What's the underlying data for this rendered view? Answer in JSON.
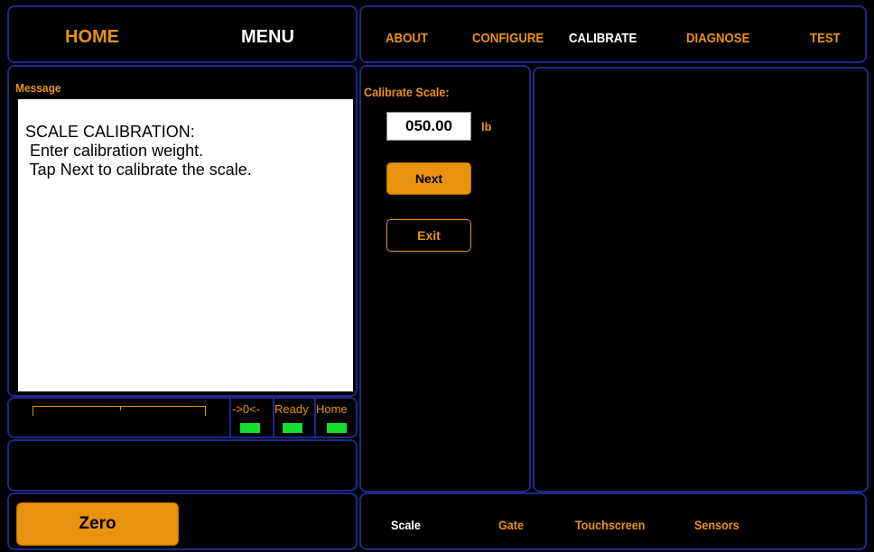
{
  "header": {
    "home_label": "HOME",
    "menu_label": "MENU",
    "tabs": [
      {
        "label": "ABOUT"
      },
      {
        "label": "CONFIGURE"
      },
      {
        "label": "CALIBRATE"
      },
      {
        "label": "DIAGNOSE"
      },
      {
        "label": "TEST"
      }
    ],
    "active_tab": "CALIBRATE"
  },
  "message": {
    "title": "Message",
    "lines": [
      "SCALE CALIBRATION:",
      " Enter calibration weight.",
      " Tap Next to calibrate the scale."
    ]
  },
  "status": {
    "indicators": [
      {
        "label": "->0<-",
        "state": "on"
      },
      {
        "label": "Ready",
        "state": "on"
      },
      {
        "label": "Home",
        "state": "on"
      }
    ]
  },
  "calibrate": {
    "title": "Calibrate Scale:",
    "weight_value": "050.00",
    "unit": "lb",
    "next_label": "Next",
    "exit_label": "Exit"
  },
  "bottom": {
    "zero_label": "Zero",
    "tabs": [
      {
        "label": "Scale"
      },
      {
        "label": "Gate"
      },
      {
        "label": "Touchscreen"
      },
      {
        "label": "Sensors"
      }
    ],
    "active_tab": "Scale"
  },
  "colors": {
    "accent": "#e8920f",
    "border": "#1d2a86",
    "led_on": "#16e02e",
    "background": "#000000"
  }
}
